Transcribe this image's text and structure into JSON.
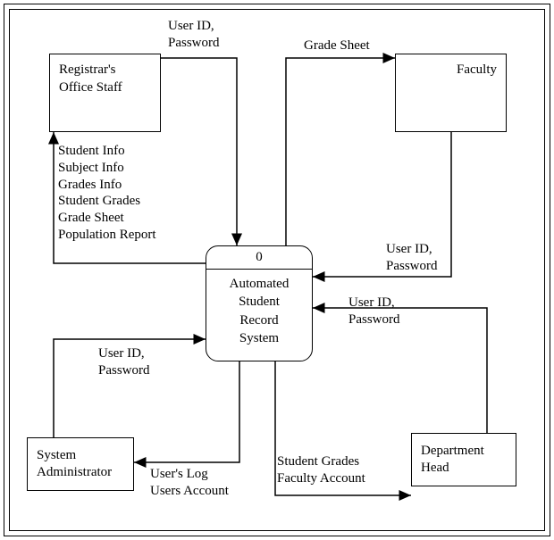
{
  "entities": {
    "registrar": "Registrar's\nOffice Staff",
    "faculty": "Faculty",
    "sysadmin": "System\nAdministrator",
    "depthead": "Department\nHead"
  },
  "process": {
    "id": "0",
    "name": "Automated\nStudent\nRecord\nSystem"
  },
  "flows": {
    "registrar_in": "User ID,\nPassword",
    "registrar_out": "Student Info\nSubject Info\nGrades Info\nStudent Grades\nGrade Sheet\nPopulation Report",
    "faculty_out": "Grade Sheet",
    "faculty_in": "User ID,\nPassword",
    "sysadmin_in": "User ID,\nPassword",
    "sysadmin_out": "User's Log\nUsers Account",
    "depthead_in": "User ID,\nPassword",
    "depthead_out": "Student Grades\nFaculty Account"
  }
}
